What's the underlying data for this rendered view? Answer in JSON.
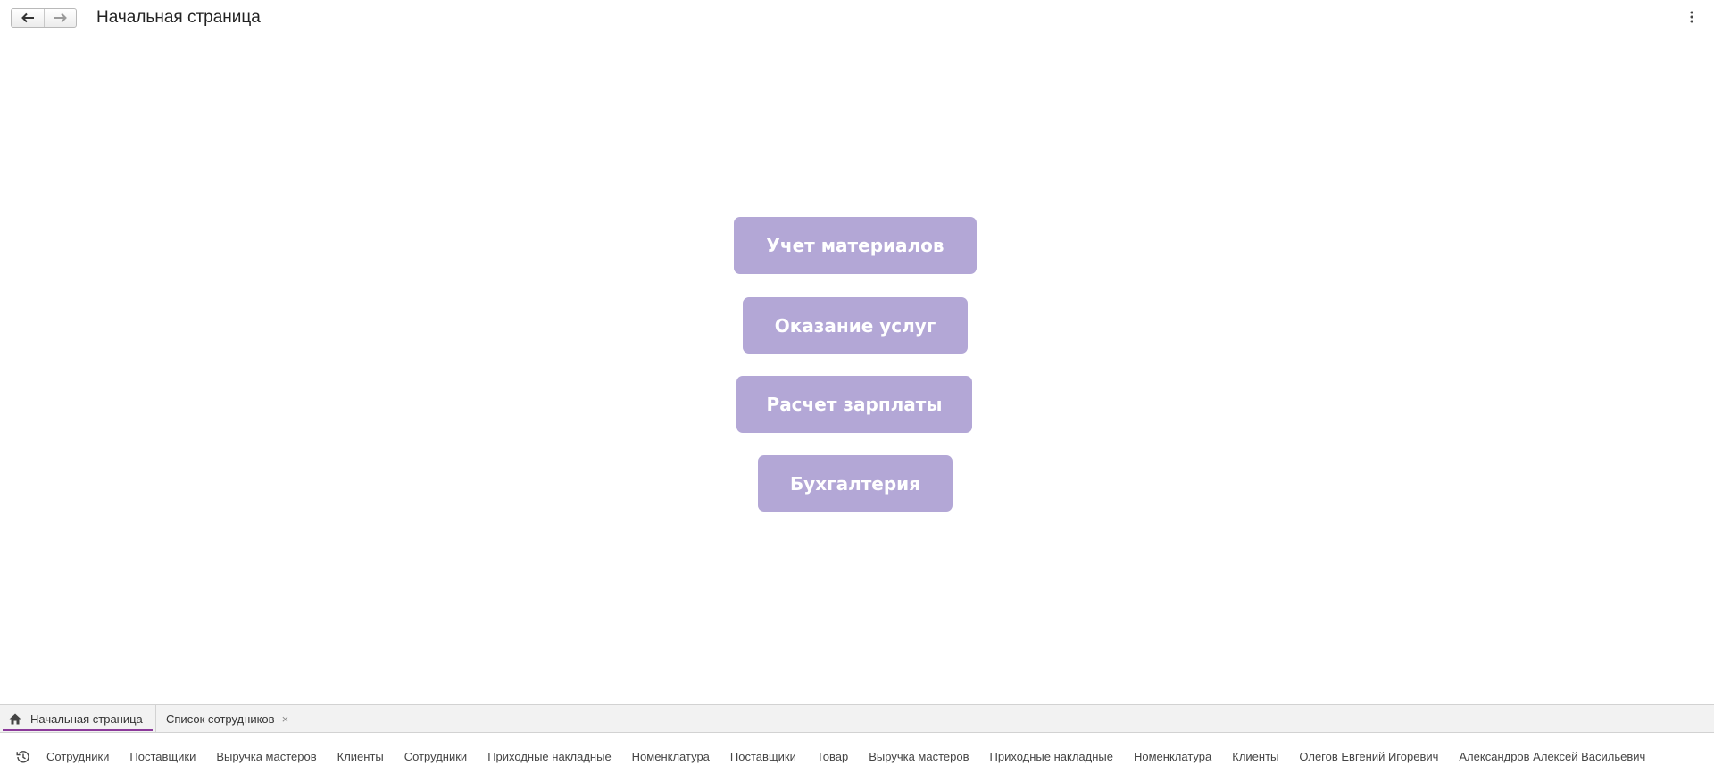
{
  "header": {
    "back_icon": "arrow-left-icon",
    "forward_icon": "arrow-right-icon",
    "title": "Начальная страница",
    "menu_icon": "more-vertical-icon"
  },
  "main": {
    "buttons": [
      {
        "label": "Учет материалов"
      },
      {
        "label": "Оказание услуг"
      },
      {
        "label": "Расчет зарплаты"
      },
      {
        "label": "Бухгалтерия"
      }
    ],
    "button_color": "#b3a7d6",
    "button_text_color": "#ffffff"
  },
  "tabs": [
    {
      "label": "Начальная страница",
      "icon": "home-icon",
      "active": true
    },
    {
      "label": "Список сотрудников",
      "closable": true,
      "close_glyph": "×"
    }
  ],
  "active_tab_accent": "#8b3a9a",
  "history": {
    "icon": "history-icon",
    "items": [
      "Сотрудники",
      "Поставщики",
      "Выручка мастеров",
      "Клиенты",
      "Сотрудники",
      "Приходные накладные",
      "Номенклатура",
      "Поставщики",
      "Товар",
      "Выручка мастеров",
      "Приходные накладные",
      "Номенклатура",
      "Клиенты",
      "Олегов Евгений Игоревич",
      "Александров Алексей Васильевич"
    ]
  }
}
